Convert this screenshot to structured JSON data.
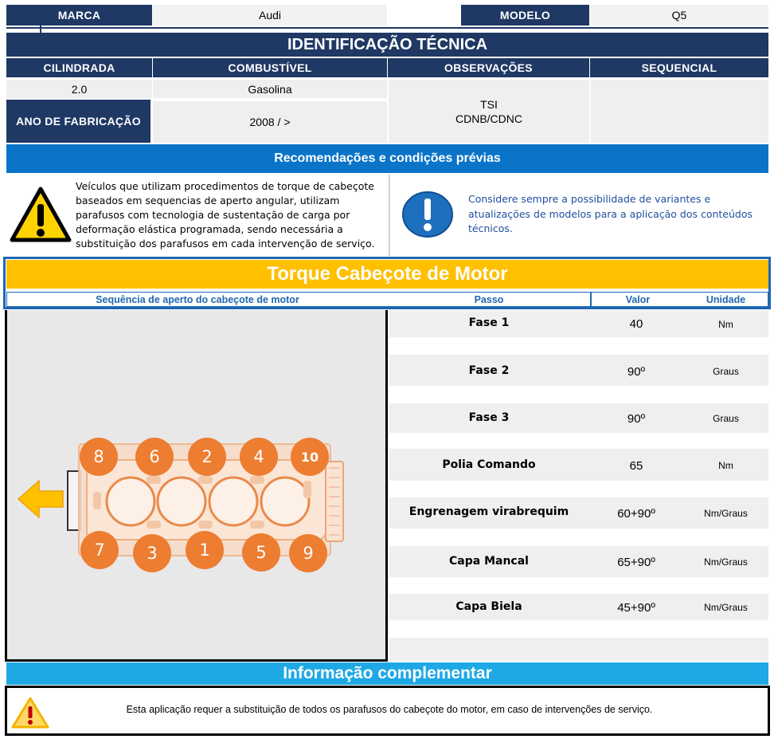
{
  "header": {
    "marca_label": "MARCA",
    "marca_value": "Audi",
    "modelo_label": "MODELO",
    "modelo_value": "Q5"
  },
  "tech": {
    "title": "IDENTIFICAÇÃO TÉCNICA",
    "cilindrada_label": "CILINDRADA",
    "combustivel_label": "COMBUSTÍVEL",
    "observacoes_label": "OBSERVAÇÕES",
    "sequencial_label": "SEQUENCIAL",
    "cilindrada_value": "2.0",
    "combustivel_value": "Gasolina",
    "ano_label": "ANO DE FABRICAÇÃO",
    "ano_value": "2008 / >",
    "obs_line1": "TSI",
    "obs_line2": "CDNB/CDNC",
    "sequencial_value": ""
  },
  "recommendations": {
    "title": "Recomendações e condições prévias",
    "warning_text": "Veículos que utilizam  procedimentos de torque de cabeçote baseados em sequencias de aperto angular, utilizam parafusos com tecnologia de sustentação de carga por deformação elástica programada, sendo necessária a substituição dos parafusos em cada intervenção de serviço.",
    "info_text": "Considere sempre a possibilidade de variantes e atualizações de modelos para a aplicação dos conteúdos técnicos."
  },
  "torque": {
    "title": "Torque Cabeçote de Motor",
    "seq_label": "Sequência de aperto do cabeçote de motor",
    "passo_label": "Passo",
    "valor_label": "Valor",
    "unidade_label": "Unidade",
    "rows": [
      {
        "step": "Fase 1",
        "value": "40",
        "unit": "Nm"
      },
      {
        "step": "Fase 2",
        "value": "90º",
        "unit": "Graus"
      },
      {
        "step": "Fase 3",
        "value": "90º",
        "unit": "Graus"
      },
      {
        "step": "Polia Comando",
        "value": "65",
        "unit": "Nm"
      },
      {
        "step": "Engrenagem virabrequim",
        "value": "60+90º",
        "unit": "Nm/Graus"
      },
      {
        "step": "Capa Mancal",
        "value": "65+90º",
        "unit": "Nm/Graus"
      },
      {
        "step": "Capa Biela",
        "value": "45+90º",
        "unit": "Nm/Graus"
      }
    ],
    "bolts_top": [
      "8",
      "6",
      "2",
      "4",
      "10"
    ],
    "bolts_bottom": [
      "7",
      "3",
      "1",
      "5",
      "9"
    ]
  },
  "complement": {
    "title": "Informação complementar",
    "text": "Esta aplicação requer a substituição de todos os parafusos do cabeçote do motor, em caso de intervenções de serviço."
  },
  "colors": {
    "navy": "#1f3864",
    "blue": "#0a74c8",
    "cyan": "#1ea8e6",
    "gold": "#ffc000",
    "orange": "#ed7d31"
  },
  "icons": [
    "warning-icon",
    "info-icon",
    "arrow-left-icon",
    "engine-diagram"
  ]
}
